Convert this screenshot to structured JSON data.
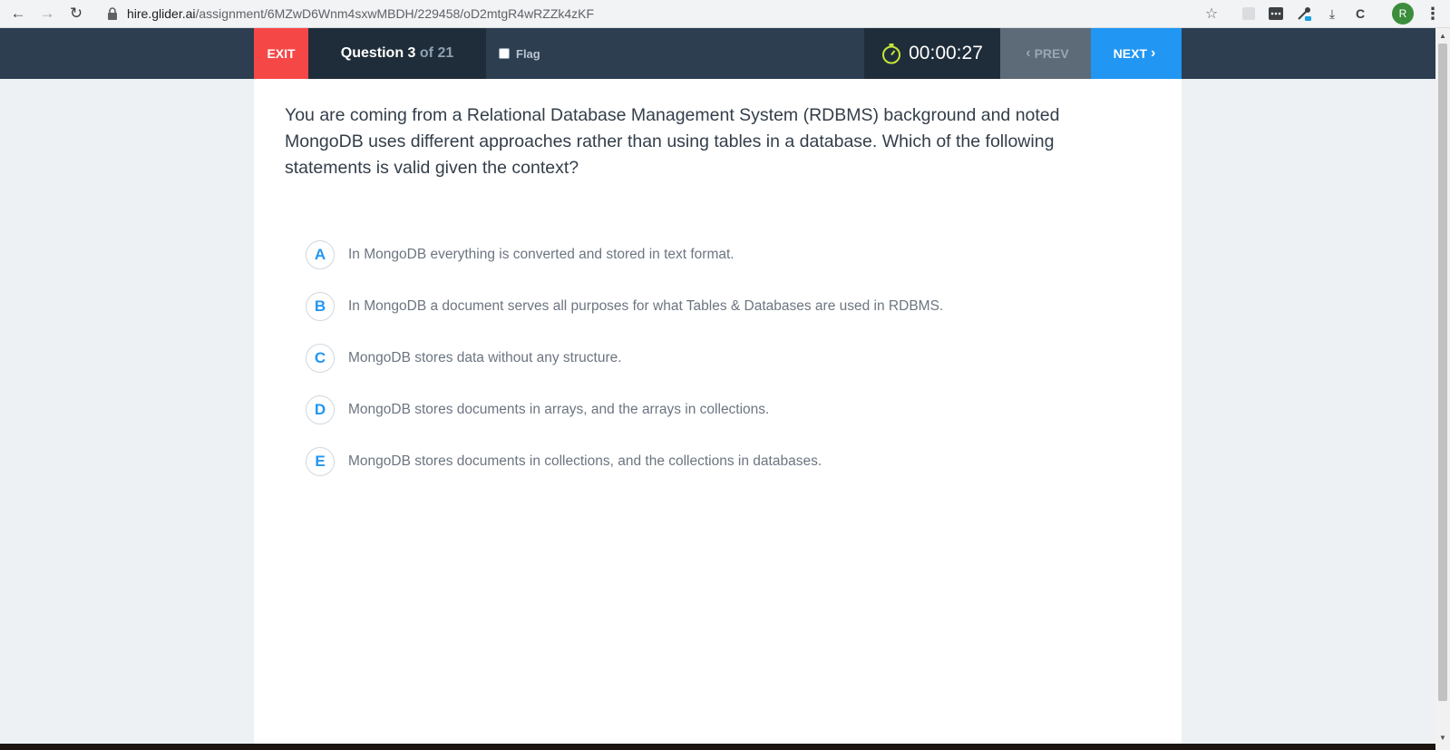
{
  "browser": {
    "url_host": "hire.glider.ai",
    "url_path": "/assignment/6MZwD6Wnm4sxwMBDH/229458/oD2mtgR4wRZZk4zKF",
    "profile_initial": "R"
  },
  "header": {
    "exit_label": "EXIT",
    "question_word": "Question",
    "question_current": "3",
    "question_total": "of 21",
    "flag_label": "Flag",
    "timer": "00:00:27",
    "prev_label": "PREV",
    "next_label": "NEXT"
  },
  "question": {
    "text": "You are coming from a Relational Database Management System (RDBMS) background and noted MongoDB uses different approaches rather than using tables in a database. Which of the following statements is valid given the context?",
    "options": [
      {
        "letter": "A",
        "text": "In MongoDB everything is converted and stored in text format."
      },
      {
        "letter": "B",
        "text": "In MongoDB a document serves all purposes for what Tables & Databases are used in RDBMS."
      },
      {
        "letter": "C",
        "text": "MongoDB stores data without any structure."
      },
      {
        "letter": "D",
        "text": "MongoDB stores documents in arrays, and the arrays in collections."
      },
      {
        "letter": "E",
        "text": "MongoDB stores documents in collections, and the collections in databases."
      }
    ]
  },
  "colors": {
    "header_bg": "#2c3e50",
    "exit_bg": "#f64747",
    "next_bg": "#2196f3",
    "prev_bg": "#5d6b78",
    "timer_icon": "#c6e636"
  }
}
